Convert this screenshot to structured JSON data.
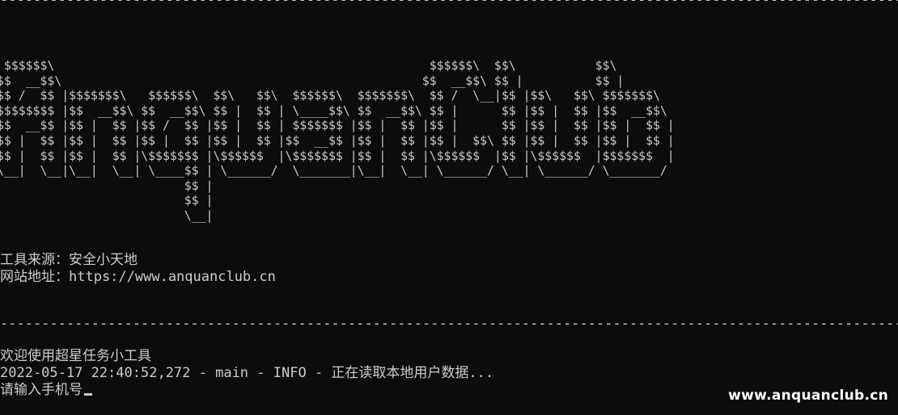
{
  "terminal": {
    "rule_top": "--------------------------------------------------------------------------------------------------------------------------------------------------------------------------------------------------------------------------------",
    "banner": [
      " $$$$$$\\                                                    $$$$$$\\  $$\\           $$\\",
      "$$  __$$\\                                                  $$  __$$\\ $$ |          $$ |",
      "$$ /  $$ |$$$$$$$\\   $$$$$$\\  $$\\   $$\\  $$$$$$\\  $$$$$$$\\  $$ /  \\__|$$ |$$\\   $$\\ $$$$$$$\\",
      "$$$$$$$$ |$$  __$$\\ $$  __$$\\ $$ |  $$ | \\____$$\\ $$  __$$\\ $$ |      $$ |$$ |  $$ |$$  __$$\\",
      "$$  __$$ |$$ |  $$ |$$ /  $$ |$$ |  $$ | $$$$$$$ |$$ |  $$ |$$ |      $$ |$$ |  $$ |$$ |  $$ |",
      "$$ |  $$ |$$ |  $$ |$$ |  $$ |$$ |  $$ |$$  __$$ |$$ |  $$ |$$ |  $$\\ $$ |$$ |  $$ |$$ |  $$ |",
      "$$ |  $$ |$$ |  $$ |\\$$$$$$$ |\\$$$$$$  |\\$$$$$$$ |$$ |  $$ |\\$$$$$$  |$$ |\\$$$$$$  |$$$$$$$  |",
      "\\__|  \\__|\\__|  \\__| \\____$$ | \\______/  \\_______|\\__|  \\__| \\______/ \\__| \\______/ \\_______/",
      "                          $$ |",
      "                          $$ |",
      "                          \\__|"
    ],
    "tool_source": "工具来源：安全小天地",
    "site_address": "网站地址：https://www.anquanclub.cn",
    "rule_middle": "--------------------------------------------------------------------------------------------------------------------------------------------------------------------------------------------------------------------------------",
    "welcome": "欢迎使用超星任务小工具",
    "log_line": "2022-05-17 22:40:52,272 - main - INFO - 正在读取本地用户数据...",
    "prompt": "请输入手机号"
  },
  "watermark": "www.anquanclub.cn"
}
